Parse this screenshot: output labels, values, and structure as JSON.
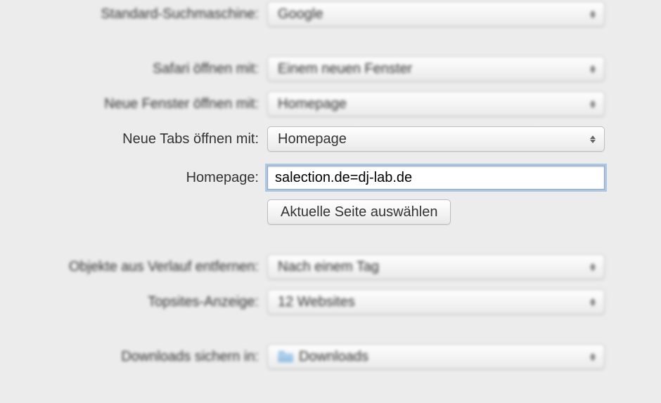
{
  "rows": {
    "search_engine": {
      "label": "Standard-Suchmaschine:",
      "value": "Google"
    },
    "safari_open": {
      "label": "Safari öffnen mit:",
      "value": "Einem neuen Fenster"
    },
    "new_windows": {
      "label": "Neue Fenster öffnen mit:",
      "value": "Homepage"
    },
    "new_tabs": {
      "label": "Neue Tabs öffnen mit:",
      "value": "Homepage"
    },
    "homepage": {
      "label": "Homepage:",
      "value": "salection.de=dj-lab.de",
      "button": "Aktuelle Seite auswählen"
    },
    "history_remove": {
      "label": "Objekte aus Verlauf entfernen:",
      "value": "Nach einem Tag"
    },
    "topsites": {
      "label": "Topsites-Anzeige:",
      "value": "12 Websites"
    },
    "downloads": {
      "label": "Downloads sichern in:",
      "value": "Downloads"
    }
  }
}
